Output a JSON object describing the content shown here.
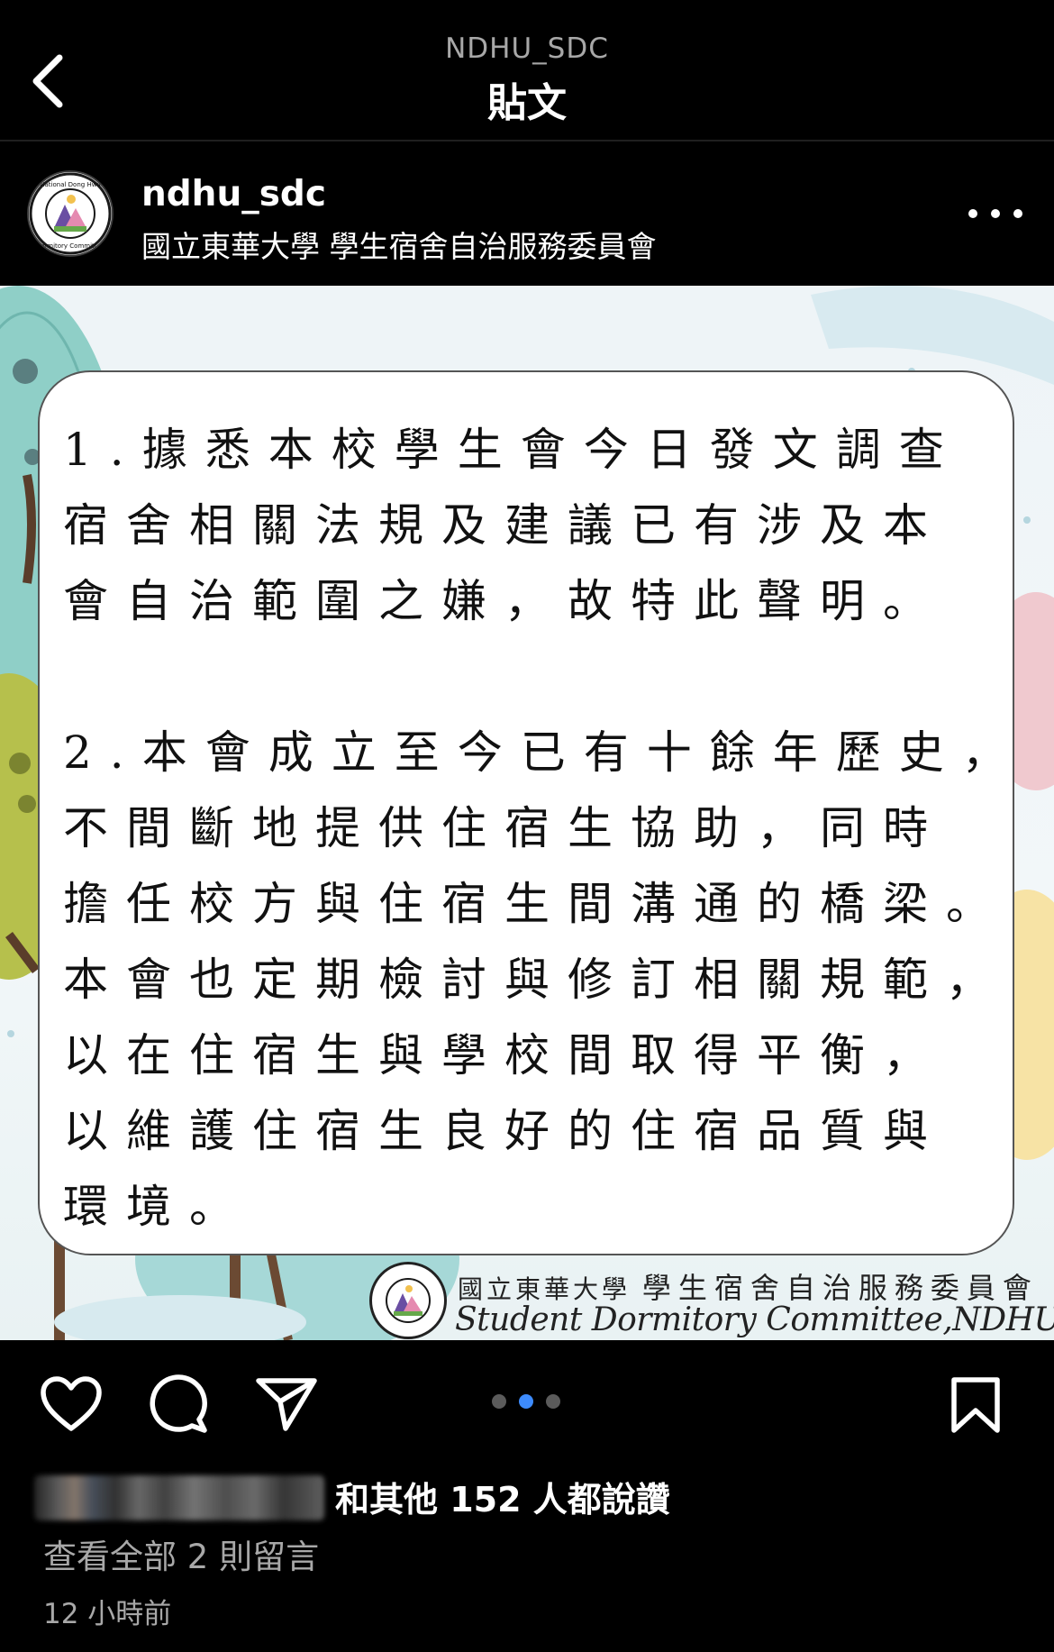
{
  "header": {
    "account": "NDHU_SDC",
    "title": "貼文",
    "back_icon": "chevron-left-icon"
  },
  "post": {
    "username": "ndhu_sdc",
    "subtitle": "國立東華大學 學生宿舍自治服務委員會",
    "more_icon": "more-horizontal-icon",
    "image_text": {
      "lines_1": [
        "1.據悉本校學生會今日發文調查",
        "宿舍相關法規及建議已有涉及本",
        "會自治範圍之嫌，故特此聲明。"
      ],
      "lines_2": [
        "2.本會成立至今已有十餘年歷史，",
        "不間斷地提供住宿生協助，同時",
        "擔任校方與住宿生間溝通的橋梁。",
        "本會也定期檢討與修訂相關規範，",
        "以在住宿生與學校間取得平衡，",
        "以維護住宿生良好的住宿品質與",
        "環境。"
      ],
      "footer_cn_left": "國立東華大學",
      "footer_cn_right": "學生宿舍自治服務委員會",
      "footer_en": "Student Dormitory Committee,NDHU"
    },
    "carousel": {
      "count": 3,
      "active_index": 1
    },
    "likes_text": "和其他 152 人都說讚",
    "comments_link": "查看全部 2 則留言",
    "timestamp": "12 小時前"
  },
  "actions": {
    "like_icon": "heart-icon",
    "comment_icon": "comment-icon",
    "share_icon": "send-icon",
    "save_icon": "bookmark-icon"
  },
  "colors": {
    "background": "#000000",
    "muted_text": "#a8a8a8",
    "carousel_active": "#3d8bfd",
    "carousel_inactive": "#5b5b5b"
  }
}
